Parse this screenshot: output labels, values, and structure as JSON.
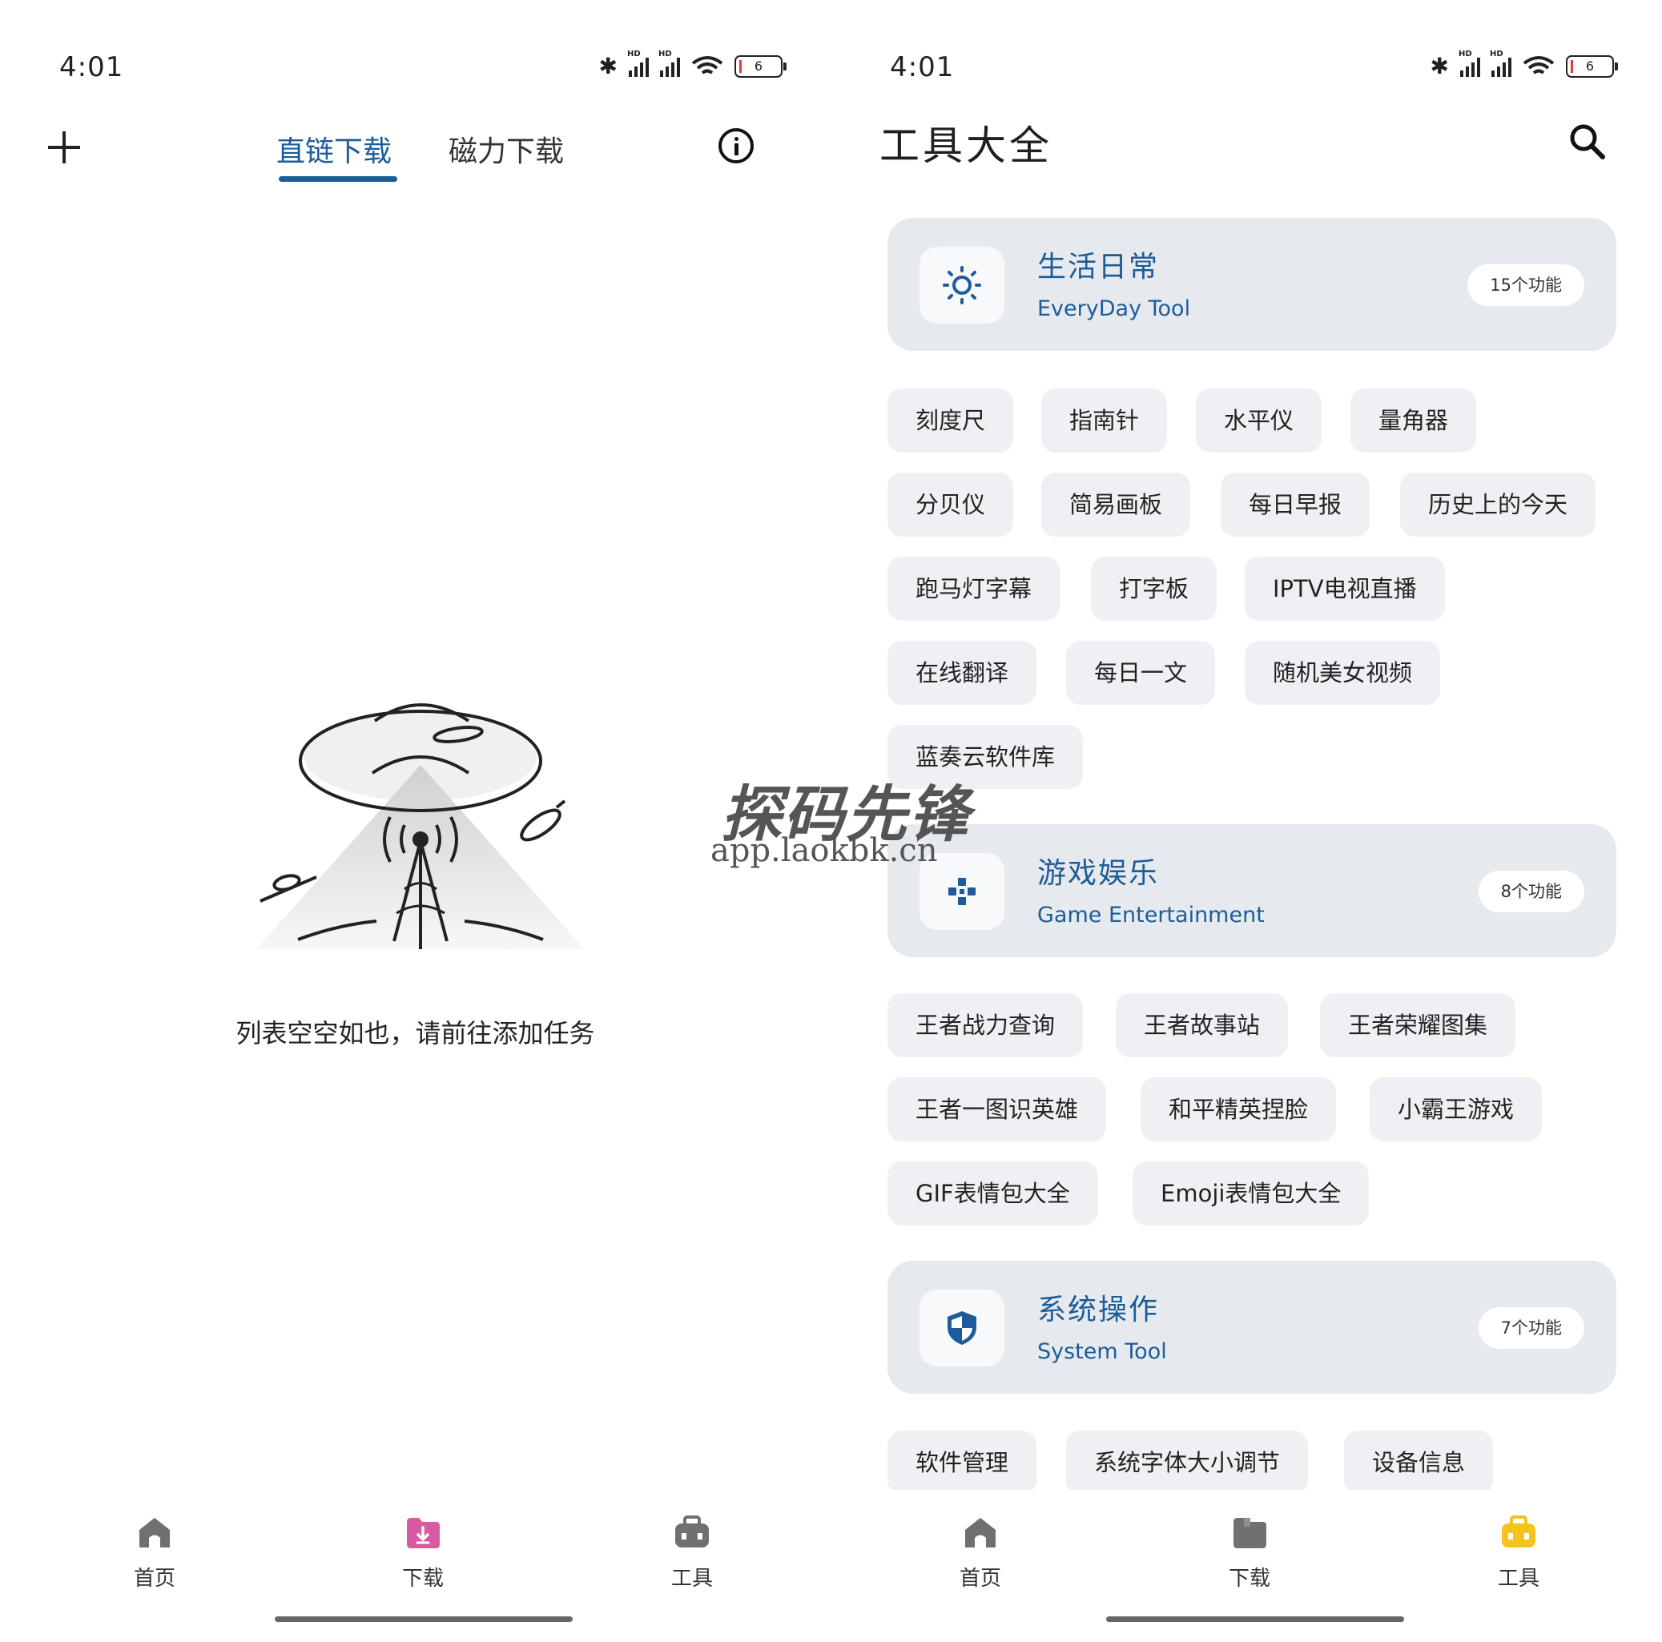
{
  "left": {
    "status": {
      "time": "4:01",
      "battery": "6",
      "hd_label": "HD"
    },
    "tabs": {
      "direct": "直链下载",
      "magnet": "磁力下载"
    },
    "empty_text": "列表空空如也，请前往添加任务",
    "nav": {
      "home": "首页",
      "download": "下载",
      "tools": "工具",
      "active": "download"
    }
  },
  "right": {
    "status": {
      "time": "4:01",
      "battery": "6",
      "hd_label": "HD"
    },
    "title": "工具大全",
    "categories": [
      {
        "title": "生活日常",
        "subtitle": "EveryDay Tool",
        "count": "15个功能",
        "icon": "sun-icon",
        "tools": [
          "刻度尺",
          "指南针",
          "水平仪",
          "量角器",
          "分贝仪",
          "简易画板",
          "每日早报",
          "历史上的今天",
          "跑马灯字幕",
          "打字板",
          "IPTV电视直播",
          "在线翻译",
          "每日一文",
          "随机美女视频",
          "蓝奏云软件库"
        ]
      },
      {
        "title": "游戏娱乐",
        "subtitle": "Game Entertainment",
        "count": "8个功能",
        "icon": "gamepad-icon",
        "tools": [
          "王者战力查询",
          "王者故事站",
          "王者荣耀图集",
          "王者一图识英雄",
          "和平精英捏脸",
          "小霸王游戏",
          "GIF表情包大全",
          "Emoji表情包大全"
        ]
      },
      {
        "title": "系统操作",
        "subtitle": "System Tool",
        "count": "7个功能",
        "icon": "shield-icon",
        "tools": [
          "软件管理",
          "系统字体大小调节",
          "设备信息"
        ]
      }
    ],
    "nav": {
      "home": "首页",
      "download": "下载",
      "tools": "工具",
      "active": "tools"
    }
  },
  "watermark": {
    "text": "探码先锋",
    "url": "app.laokbk.cn"
  },
  "colors": {
    "accent": "#1d5c98",
    "download_active": "#d95aa0",
    "tools_active": "#f4c31c",
    "card_bg": "#e6eaef",
    "chip_bg": "#eef0f3"
  }
}
